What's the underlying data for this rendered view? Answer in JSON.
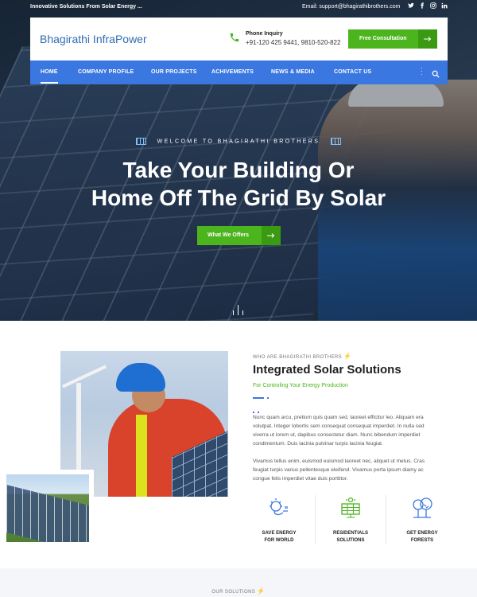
{
  "topbar": {
    "tagline": "Innovative Solutions From Solar Energy ...",
    "email": "Email: support@bhagirathibrothers.com",
    "social": [
      {
        "icon": "twitter-icon",
        "glyph": "t"
      },
      {
        "icon": "facebook-icon",
        "glyph": "f"
      },
      {
        "icon": "instagram-icon",
        "glyph": "◎"
      },
      {
        "icon": "linkedin-icon",
        "glyph": "in"
      }
    ]
  },
  "header": {
    "logo": "Bhagirathi InfraPower",
    "phone_label": "Phone Inquiry",
    "phone_numbers": "+91-120 425 9441, 9810-520-822",
    "cta_label": "Free Consultation"
  },
  "nav": {
    "items": [
      "HOME",
      "COMPANY PROFILE",
      "OUR PROJECTS",
      "ACHIVEMENTS",
      "NEWS & MEDIA",
      "CONTACT US"
    ],
    "active": "HOME"
  },
  "hero": {
    "welcome": "WELCOME TO BHAGIRATHI BROTHERS",
    "headline_line1": "Take Your Building Or",
    "headline_line2": "Home Off The Grid By Solar",
    "button_label": "What We Offers"
  },
  "about": {
    "sub_label": "WHO ARE BHAGIRATHI BROTHERS",
    "title": "Integrated Solar Solutions",
    "tagline": "For Controling Your Energy Production",
    "paragraph1": "Nunc quam arcu, pretium quis quam sed, laoreet efficitur leo. Aliquam era volutpat. Integer lobortis sem consequat consequat imperdiet. In nulla sed viverra ut lorem ut, dapibus consectetur diam. Nunc bibendum imperdiet condimentum. Duis lacinia pulvinar turpis lacinia feugiat.",
    "paragraph2": "Vivamus tellus enim, euismod euismod laoreet nec, aliquet ut metus. Cras feugiat turpis varius pellentesque eleifend. Vivamus porta ipsum diamy ac congue felis imperdiet vitae duis porttitor.",
    "features": [
      {
        "icon": "bulb-plug-icon",
        "line1": "SAVE ENERGY",
        "line2": "FOR WORLD"
      },
      {
        "icon": "solar-panel-icon",
        "line1": "RESIDENTIALS",
        "line2": "SOLUTIONS"
      },
      {
        "icon": "trees-icon",
        "line1": "GET ENERGY",
        "line2": "FORESTS"
      }
    ]
  },
  "solutions": {
    "label": "OUR SOLUTIONS"
  },
  "colors": {
    "primary_blue": "#3b77e0",
    "accent_green": "#4cb51e",
    "logo_blue": "#2d6db4"
  }
}
